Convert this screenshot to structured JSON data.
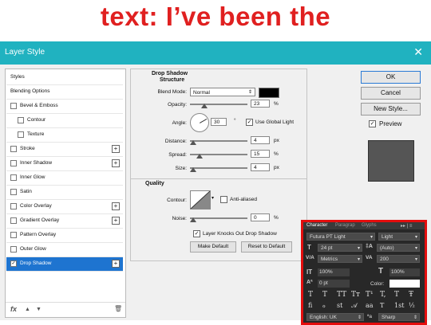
{
  "header": {
    "caption": "text: I’ve been the"
  },
  "window": {
    "title": "Layer Style",
    "close_glyph": "✕"
  },
  "sidebar": {
    "items": [
      {
        "label": "Styles",
        "checkbox": false,
        "checked": false,
        "plus": false,
        "active": false
      },
      {
        "label": "Blending Options",
        "checkbox": false,
        "checked": false,
        "plus": false,
        "active": false
      },
      {
        "label": "Bevel & Emboss",
        "checkbox": true,
        "checked": false,
        "plus": false,
        "active": false
      },
      {
        "label": "Contour",
        "checkbox": true,
        "checked": false,
        "plus": false,
        "active": false,
        "indent": true
      },
      {
        "label": "Texture",
        "checkbox": true,
        "checked": false,
        "plus": false,
        "active": false,
        "indent": true
      },
      {
        "label": "Stroke",
        "checkbox": true,
        "checked": false,
        "plus": true,
        "active": false
      },
      {
        "label": "Inner Shadow",
        "checkbox": true,
        "checked": false,
        "plus": true,
        "active": false
      },
      {
        "label": "Inner Glow",
        "checkbox": true,
        "checked": false,
        "plus": false,
        "active": false
      },
      {
        "label": "Satin",
        "checkbox": true,
        "checked": false,
        "plus": false,
        "active": false
      },
      {
        "label": "Color Overlay",
        "checkbox": true,
        "checked": false,
        "plus": true,
        "active": false
      },
      {
        "label": "Gradient Overlay",
        "checkbox": true,
        "checked": false,
        "plus": true,
        "active": false
      },
      {
        "label": "Pattern Overlay",
        "checkbox": true,
        "checked": false,
        "plus": false,
        "active": false
      },
      {
        "label": "Outer Glow",
        "checkbox": true,
        "checked": false,
        "plus": false,
        "active": false
      },
      {
        "label": "Drop Shadow",
        "checkbox": true,
        "checked": true,
        "plus": true,
        "active": true
      }
    ],
    "footer": {
      "fx": "fx",
      "up": "▲",
      "down": "▼",
      "trash": "🗑"
    }
  },
  "drop_shadow": {
    "heading": "Drop Shadow",
    "subheading": "Structure",
    "blend_mode_label": "Blend Mode:",
    "blend_mode_value": "Normal",
    "shadow_color": "#000000",
    "opacity_label": "Opacity:",
    "opacity_value": "23",
    "opacity_unit": "%",
    "angle_label": "Angle:",
    "angle_value": "30",
    "angle_unit": "°",
    "use_global_light_label": "Use Global Light",
    "use_global_light_checked": true,
    "distance_label": "Distance:",
    "distance_value": "4",
    "distance_unit": "px",
    "spread_label": "Spread:",
    "spread_value": "15",
    "spread_unit": "%",
    "size_label": "Size:",
    "size_value": "4",
    "size_unit": "px"
  },
  "quality": {
    "heading": "Quality",
    "contour_label": "Contour:",
    "anti_aliased_label": "Anti-aliased",
    "noise_label": "Noise:",
    "noise_value": "0",
    "noise_unit": "%",
    "knockout_label": "Layer Knocks Out Drop Shadow",
    "knockout_checked": true,
    "make_default": "Make Default",
    "reset_default": "Reset to Default"
  },
  "buttons": {
    "ok": "OK",
    "cancel": "Cancel",
    "new_style": "New Style...",
    "preview_label": "Preview",
    "preview_checked": true
  },
  "character_panel": {
    "tabs": [
      "Character",
      "Paragrap",
      "Glyphs"
    ],
    "tab_menu": "▸▸ | ≡",
    "font_family": "Futura PT Light",
    "font_style": "Light",
    "font_size": "24 pt",
    "leading": "(Auto)",
    "kerning": "Metrics",
    "tracking": "200",
    "vertical_scale": "100%",
    "horizontal_scale": "100%",
    "baseline_shift": "0 pt",
    "color_label": "Color:",
    "color_value": "#ffffff",
    "type_styles": [
      "T",
      "T",
      "TT",
      "Tт",
      "T¹",
      "T,",
      "T",
      "Ŧ"
    ],
    "opentype": [
      "fi",
      "ℴ",
      "st",
      "𝒜",
      "aa",
      "T",
      "1st",
      "½"
    ],
    "language": "English: UK",
    "aa_label": "ªa",
    "anti_alias": "Sharp",
    "icons": {
      "size": "T",
      "leading": "‡A",
      "kerning": "V/A",
      "tracking": "VA",
      "vscale": "IT",
      "hscale": "T",
      "baseline": "Aª"
    }
  }
}
